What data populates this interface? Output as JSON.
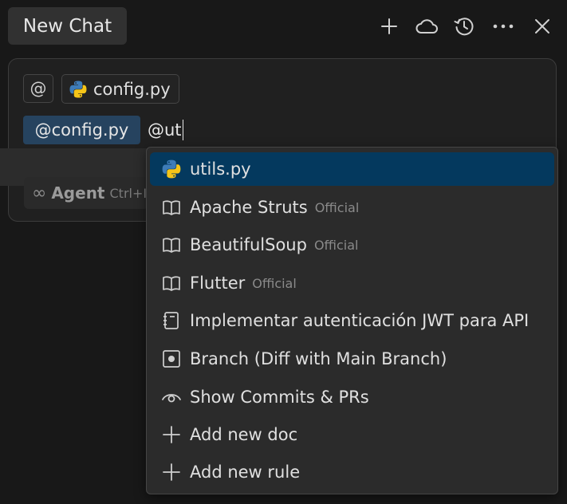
{
  "header": {
    "title": "New Chat",
    "actions": [
      {
        "name": "new-chat-icon"
      },
      {
        "name": "cloud-icon"
      },
      {
        "name": "history-icon"
      },
      {
        "name": "more-icon"
      },
      {
        "name": "close-icon"
      }
    ]
  },
  "composer": {
    "at_symbol": "@",
    "context_file": "config.py",
    "mention": "@config.py",
    "typed": "@ut",
    "mode_label": "Agent",
    "mode_shortcut": "Ctrl+I"
  },
  "dropdown": {
    "items": [
      {
        "icon": "python-icon",
        "label": "utils.py",
        "badge": "",
        "selected": true
      },
      {
        "icon": "book-icon",
        "label": "Apache Struts",
        "badge": "Official"
      },
      {
        "icon": "book-icon",
        "label": "BeautifulSoup",
        "badge": "Official"
      },
      {
        "icon": "book-icon",
        "label": "Flutter",
        "badge": "Official"
      },
      {
        "icon": "notebook-icon",
        "label": "Implementar autenticación JWT para API",
        "badge": ""
      },
      {
        "icon": "branch-diff-icon",
        "label": "Branch (Diff with Main Branch)",
        "badge": ""
      },
      {
        "icon": "eye-icon",
        "label": "Show Commits & PRs",
        "badge": ""
      },
      {
        "icon": "plus-icon",
        "label": "Add new doc",
        "badge": ""
      },
      {
        "icon": "plus-icon",
        "label": "Add new rule",
        "badge": ""
      }
    ]
  },
  "colors": {
    "background": "#181818",
    "composer": "#202020",
    "dropdown": "#2b2b2b",
    "selected": "#04395e",
    "mention": "#26435f"
  }
}
